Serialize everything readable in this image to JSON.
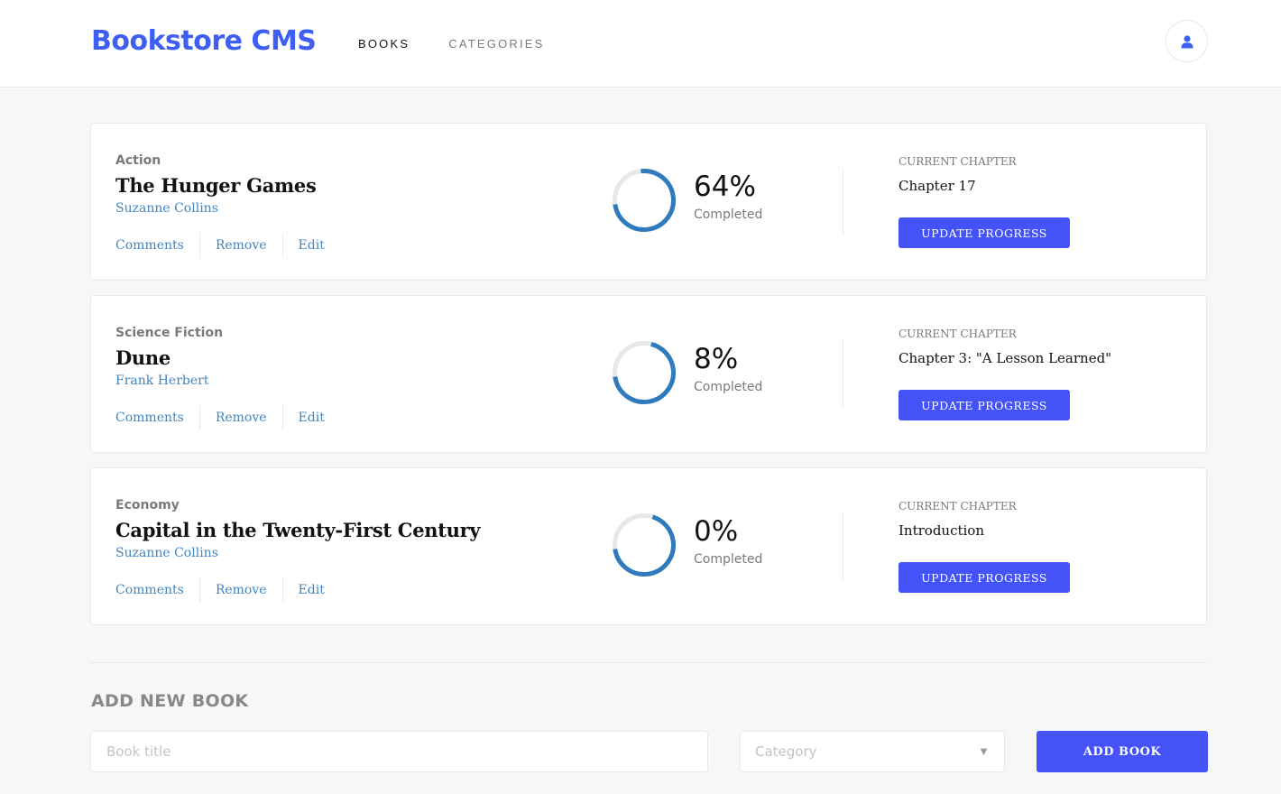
{
  "header": {
    "logo": "Bookstore CMS",
    "nav": [
      {
        "label": "BOOKS"
      },
      {
        "label": "CATEGORIES"
      }
    ],
    "avatar_icon": "user-icon"
  },
  "colors": {
    "brand": "#3e5ff2",
    "button": "#4353f8",
    "link": "#4386bf",
    "progress": "#307bbe"
  },
  "books": [
    {
      "genre": "Action",
      "title": "The Hunger Games",
      "author": "Suzanne Collins",
      "actions": [
        "Comments",
        "Remove",
        "Edit"
      ],
      "progress": 64,
      "percent_label": "64%",
      "completed_label": "Completed",
      "current_chapter_label": "CURRENT CHAPTER",
      "current_chapter": "Chapter 17",
      "update_label": "UPDATE PROGRESS"
    },
    {
      "genre": "Science Fiction",
      "title": "Dune",
      "author": "Frank Herbert",
      "actions": [
        "Comments",
        "Remove",
        "Edit"
      ],
      "progress": 8,
      "percent_label": "8%",
      "completed_label": "Completed",
      "current_chapter_label": "CURRENT CHAPTER",
      "current_chapter": "Chapter 3: \"A Lesson Learned\"",
      "update_label": "UPDATE PROGRESS"
    },
    {
      "genre": "Economy",
      "title": "Capital in the Twenty-First Century",
      "author": "Suzanne Collins",
      "actions": [
        "Comments",
        "Remove",
        "Edit"
      ],
      "progress": 0,
      "percent_label": "0%",
      "completed_label": "Completed",
      "current_chapter_label": "CURRENT CHAPTER",
      "current_chapter": "Introduction",
      "update_label": "UPDATE PROGRESS"
    }
  ],
  "add_form": {
    "title": "ADD NEW BOOK",
    "title_placeholder": "Book title",
    "title_value": "",
    "category_placeholder": "Category",
    "submit_label": "ADD BOOK"
  }
}
